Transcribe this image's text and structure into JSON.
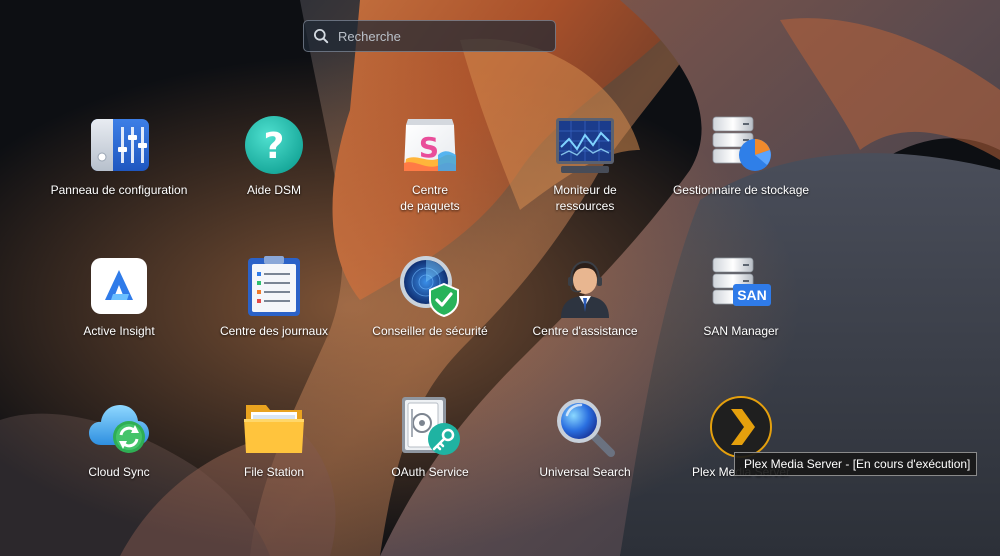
{
  "search": {
    "placeholder": "Recherche",
    "icon": "search-icon"
  },
  "apps": [
    {
      "id": "panneau",
      "label": "Panneau de configuration",
      "icon": "control-panel-icon"
    },
    {
      "id": "aide",
      "label": "Aide DSM",
      "icon": "help-icon"
    },
    {
      "id": "paquets",
      "label": "Centre\nde paquets",
      "icon": "package-center-icon"
    },
    {
      "id": "moniteur",
      "label": "Moniteur de\nressources",
      "icon": "resource-monitor-icon"
    },
    {
      "id": "stockage",
      "label": "Gestionnaire de stockage",
      "icon": "storage-manager-icon"
    },
    {
      "id": "insight",
      "label": "Active Insight",
      "icon": "active-insight-icon"
    },
    {
      "id": "journaux",
      "label": "Centre des journaux",
      "icon": "log-center-icon"
    },
    {
      "id": "securite",
      "label": "Conseiller de sécurité",
      "icon": "security-advisor-icon"
    },
    {
      "id": "assistance",
      "label": "Centre d'assistance",
      "icon": "support-center-icon"
    },
    {
      "id": "san",
      "label": "SAN Manager",
      "icon": "san-manager-icon",
      "badge": "SAN"
    },
    {
      "id": "cloudsync",
      "label": "Cloud Sync",
      "icon": "cloud-sync-icon"
    },
    {
      "id": "filestation",
      "label": "File Station",
      "icon": "file-station-icon"
    },
    {
      "id": "oauth",
      "label": "OAuth Service",
      "icon": "oauth-service-icon"
    },
    {
      "id": "usearch",
      "label": "Universal Search",
      "icon": "universal-search-icon"
    },
    {
      "id": "plex",
      "label": "Plex Media Server",
      "icon": "plex-icon"
    }
  ],
  "tooltip": {
    "text": "Plex Media Server - [En cours d'exécution]"
  },
  "colors": {
    "accent": "#2f6fd6",
    "plex_orange": "#e5a00d",
    "help_teal": "#20b8a8"
  }
}
